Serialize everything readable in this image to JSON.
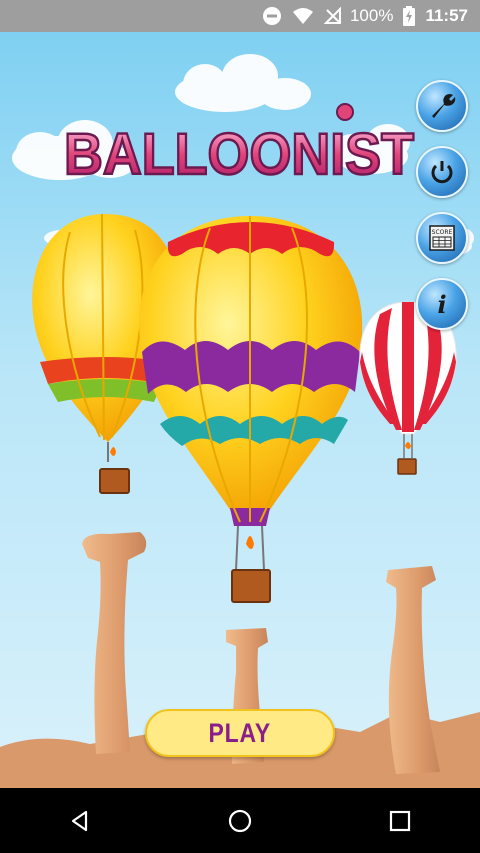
{
  "status_bar": {
    "battery_percent": "100%",
    "time": "11:57",
    "icons": [
      "minus-circle-icon",
      "wifi-icon",
      "no-signal-icon",
      "battery-charging-icon"
    ]
  },
  "game": {
    "title": "BALLOONIST",
    "play_label": "PLAY",
    "menu_buttons": [
      "settings-wrench-icon",
      "power-icon",
      "scoreboard-icon",
      "info-icon"
    ],
    "score_icon_text": "SCORE",
    "info_icon_text": "i"
  },
  "colors": {
    "sky_top": "#7fd0f2",
    "play_button_bg": "#ffea86",
    "play_text": "#8a1f8c",
    "menu_button": "#4aa3e6",
    "rock": "#e0a277"
  },
  "nav_bar": {
    "buttons": [
      "back-triangle-icon",
      "home-circle-icon",
      "recents-square-icon"
    ]
  }
}
